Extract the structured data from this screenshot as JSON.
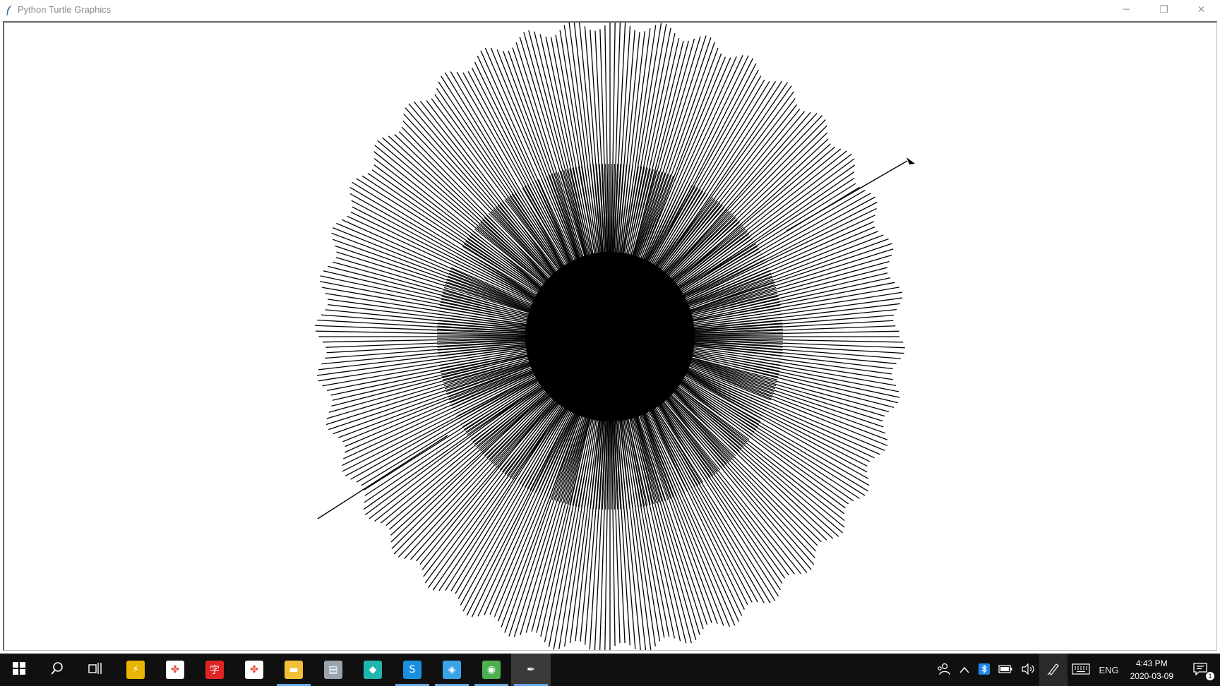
{
  "window": {
    "title": "Python Turtle Graphics",
    "icon": "feather-icon",
    "controls": {
      "minimize": "─",
      "restore": "❐",
      "close": "✕"
    }
  },
  "canvas": {
    "background": "#ffffff",
    "pen_color": "#000000",
    "drawing": "radial-line-burst",
    "rays": 360
  },
  "taskbar": {
    "background": "#101010",
    "start_icon": "windows-logo-icon",
    "search_icon": "search-icon",
    "taskview_icon": "task-view-icon",
    "pinned_apps": [
      {
        "name": "app-yellow-network",
        "glyph": "⚡",
        "color": "#e8b400",
        "active": false
      },
      {
        "name": "app-pinwheel",
        "glyph": "✤",
        "color": "#ffffff",
        "active": false
      },
      {
        "name": "app-red-character",
        "glyph": "字",
        "color": "#e02424",
        "active": false
      },
      {
        "name": "app-pinwheel-2",
        "glyph": "✤",
        "color": "#ffffff",
        "active": false
      },
      {
        "name": "file-explorer",
        "glyph": "▬",
        "color": "#f2c038",
        "active": true
      },
      {
        "name": "app-gray-folder",
        "glyph": "▤",
        "color": "#9aa4ad",
        "active": false
      },
      {
        "name": "app-teal-box",
        "glyph": "◆",
        "color": "#1fb5b0",
        "active": false
      },
      {
        "name": "skype",
        "glyph": "S",
        "color": "#1a8fe0",
        "active": true
      },
      {
        "name": "app-blue-diamond",
        "glyph": "◈",
        "color": "#3aa3e8",
        "active": true
      },
      {
        "name": "app-green-globe",
        "glyph": "◉",
        "color": "#4caf50",
        "active": true
      },
      {
        "name": "python-turtle",
        "glyph": "✒",
        "color": "#3a3a3a",
        "active": true
      }
    ],
    "tray": {
      "people_icon": "people-icon",
      "chevron_icon": "chevron-up-icon",
      "bluetooth_icon": "bluetooth-icon",
      "battery_icon": "battery-icon",
      "volume_icon": "volume-icon",
      "pen_icon": "pen-icon",
      "keyboard_icon": "keyboard-icon",
      "language": "ENG",
      "time": "4:43 PM",
      "date": "2020-03-09",
      "notification_count": "1"
    }
  }
}
